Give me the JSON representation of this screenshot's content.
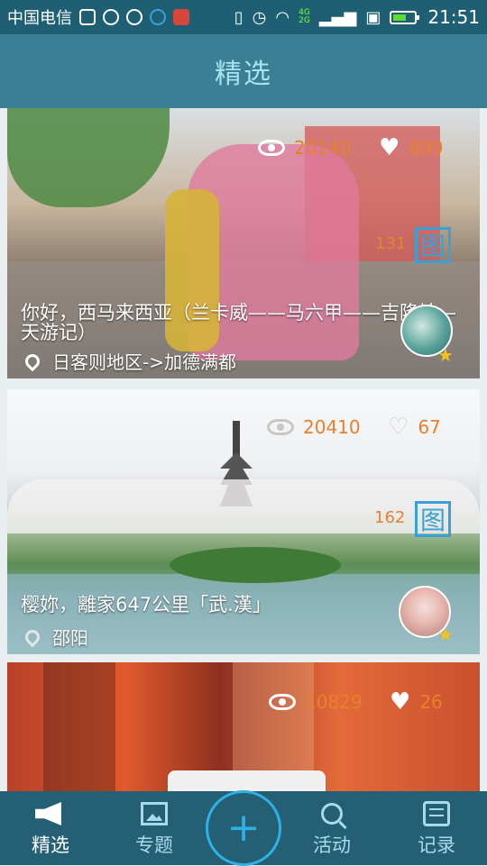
{
  "status_bar": {
    "carrier": "中国电信",
    "network_type_top": "4G",
    "network_type_bottom": "2G",
    "time": "21:51",
    "icons": [
      "gallery-icon",
      "usb-icon",
      "usb-icon",
      "qq-icon",
      "app-notification-icon",
      "vibrate-icon",
      "alarm-icon",
      "wifi-icon",
      "signal-icon",
      "sim-icon",
      "battery-icon"
    ]
  },
  "header": {
    "title": "精选"
  },
  "cards": [
    {
      "views": "20140",
      "likes": "899",
      "count": "131",
      "badge": "图",
      "title": "你好，西马来西亚（兰卡威——马六甲——吉隆坡—天游记）",
      "location": "日客则地区->加德满都"
    },
    {
      "views": "20410",
      "likes": "67",
      "count": "162",
      "badge": "图",
      "title": "樱妳，離家647公里「武.漢」",
      "location": "邵阳"
    },
    {
      "views": "10829",
      "likes": "26"
    }
  ],
  "tabs": [
    {
      "label": "精选",
      "icon": "megaphone-icon",
      "active": true
    },
    {
      "label": "专题",
      "icon": "picture-icon",
      "active": false
    },
    {
      "label": "活动",
      "icon": "search-icon",
      "active": false
    },
    {
      "label": "记录",
      "icon": "record-icon",
      "active": false
    }
  ],
  "add_button": {
    "label": "+"
  },
  "colors": {
    "status_bar": "#1f5f73",
    "header": "#3a7f94",
    "header_title": "#a9e3f2",
    "tab_bar": "#245f74",
    "stat_text": "#e8802d",
    "badge_blue": "#3aa0d8",
    "add_ring": "#2fb1e8"
  }
}
